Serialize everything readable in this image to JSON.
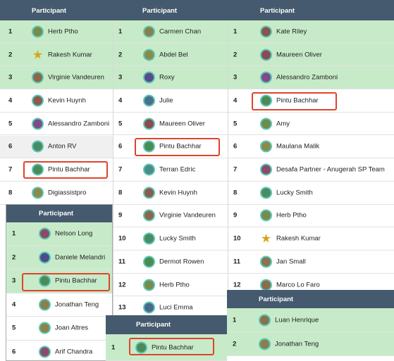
{
  "header_label": "Participant",
  "colors": {
    "header": "#455a6e",
    "row_green": "#c7ebc9",
    "highlight": "#e0432b",
    "avatar_ring": "#5cc7b8"
  },
  "col1": [
    {
      "n": "1",
      "name": "Herb Ptho"
    },
    {
      "n": "2",
      "name": "Rakesh Kumar"
    },
    {
      "n": "3",
      "name": "Virginie Vandeuren"
    },
    {
      "n": "4",
      "name": "Kevin Huynh"
    },
    {
      "n": "5",
      "name": "Alessandro Zamboni"
    },
    {
      "n": "6",
      "name": "Anton RV"
    },
    {
      "n": "7",
      "name": "Pintu Bachhar"
    },
    {
      "n": "8",
      "name": "Digiassistpro"
    }
  ],
  "col2": [
    {
      "n": "1",
      "name": "Carmen Chan"
    },
    {
      "n": "2",
      "name": "Abdel Bel"
    },
    {
      "n": "3",
      "name": "Roxy"
    },
    {
      "n": "4",
      "name": "Julie"
    },
    {
      "n": "5",
      "name": "Maureen Oliver"
    },
    {
      "n": "6",
      "name": "Pintu Bachhar"
    },
    {
      "n": "7",
      "name": "Terran Edric"
    },
    {
      "n": "8",
      "name": "Kevin Huynh"
    },
    {
      "n": "9",
      "name": "Virginie Vandeuren"
    },
    {
      "n": "10",
      "name": "Lucky Smith"
    },
    {
      "n": "11",
      "name": "Dermot Rowen"
    },
    {
      "n": "12",
      "name": "Herb Ptho"
    },
    {
      "n": "13",
      "name": "Luci Emma"
    }
  ],
  "col3": [
    {
      "n": "1",
      "name": "Kate Riley"
    },
    {
      "n": "2",
      "name": "Maureen Oliver"
    },
    {
      "n": "3",
      "name": "Alessandro Zamboni"
    },
    {
      "n": "4",
      "name": "Pintu Bachhar"
    },
    {
      "n": "5",
      "name": "Amy"
    },
    {
      "n": "6",
      "name": "Maulana Malik"
    },
    {
      "n": "7",
      "name": "Desafa Partner - Anugerah SP Team"
    },
    {
      "n": "8",
      "name": "Lucky Smith"
    },
    {
      "n": "9",
      "name": "Herb Ptho"
    },
    {
      "n": "10",
      "name": "Rakesh Kumar"
    },
    {
      "n": "11",
      "name": "Jan Small"
    },
    {
      "n": "12",
      "name": "Marco Lo Faro"
    }
  ],
  "panel4": [
    {
      "n": "1",
      "name": "Nelson Long"
    },
    {
      "n": "2",
      "name": "Daniele Melandri"
    },
    {
      "n": "3",
      "name": "Pintu Bachhar"
    },
    {
      "n": "4",
      "name": "Jonathan Teng"
    },
    {
      "n": "5",
      "name": "Joan Altres"
    },
    {
      "n": "6",
      "name": "Arif Chandra"
    }
  ],
  "panel5": [
    {
      "n": "1",
      "name": "Pintu Bachhar"
    }
  ],
  "panel6": [
    {
      "n": "1",
      "name": "Luan Henrique"
    },
    {
      "n": "2",
      "name": "Jonathan Teng"
    }
  ]
}
